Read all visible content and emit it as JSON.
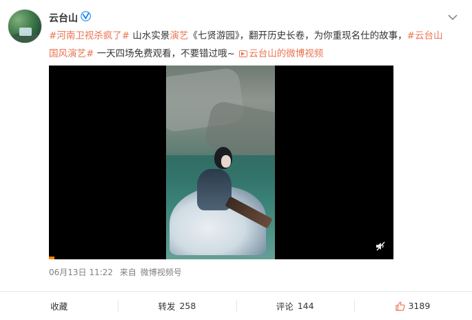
{
  "account": {
    "username": "云台山",
    "verified_icon": "verified-badge-icon"
  },
  "post": {
    "parts": [
      {
        "text": "#河南卫视杀疯了#",
        "style": "hl"
      },
      {
        "text": " 山水实景",
        "style": "normal"
      },
      {
        "text": "演艺",
        "style": "hl"
      },
      {
        "text": "《七贤游园》，翻开历史长卷，为你重现名仕的故事，",
        "style": "normal"
      },
      {
        "text": "#云台山国风演艺#",
        "style": "hl"
      },
      {
        "text": " 一天四场免费观看，不要错过哦~ ",
        "style": "normal"
      }
    ],
    "video_link": "云台山的微博视频"
  },
  "video": {
    "progress_fraction": 0.016,
    "mute_icon": "mute-icon"
  },
  "meta": {
    "date": "06月13日 11:22",
    "from_label": "来自",
    "source": "微博视频号"
  },
  "actions": {
    "favorite_label": "收藏",
    "repost_label": "转发",
    "repost_count": "258",
    "comment_label": "评论",
    "comment_count": "144",
    "like_icon": "thumbs-up-icon",
    "like_count": "3189"
  },
  "colors": {
    "accent": "#eb7350",
    "muted": "#808080",
    "progress": "#ff8200"
  }
}
